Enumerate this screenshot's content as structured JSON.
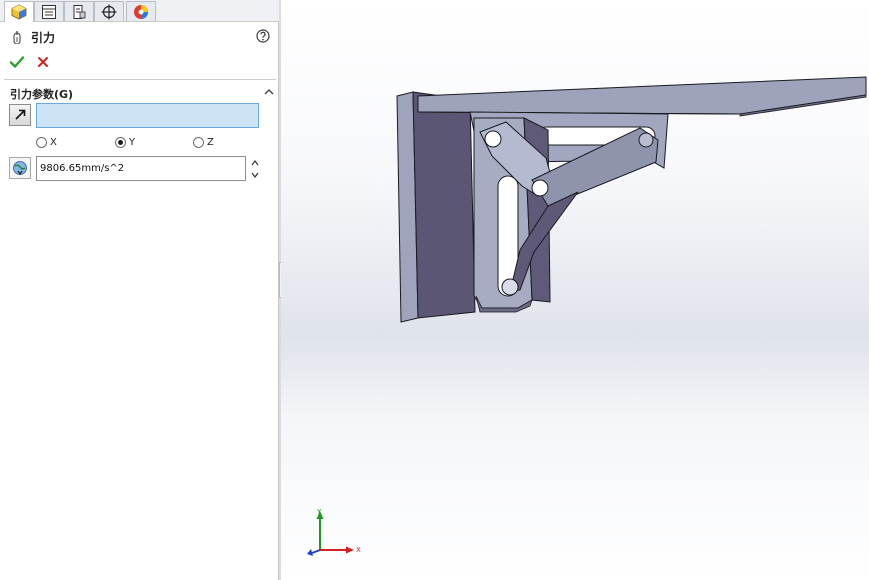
{
  "property_manager": {
    "title": "引力",
    "group": {
      "title": "引力参数(G)"
    },
    "direction": {
      "value": ""
    },
    "axes": [
      {
        "label": "X",
        "selected": false
      },
      {
        "label": "Y",
        "selected": true
      },
      {
        "label": "Z",
        "selected": false
      }
    ],
    "gravity": {
      "value": "9806.65mm/s^2"
    }
  },
  "tabs": [
    {
      "icon": "feature-manager-icon",
      "active": true
    },
    {
      "icon": "property-manager-icon",
      "active": false
    },
    {
      "icon": "configuration-manager-icon",
      "active": false
    },
    {
      "icon": "dimxpert-manager-icon",
      "active": false
    },
    {
      "icon": "display-manager-icon",
      "active": false
    }
  ],
  "triad": {
    "x_label": "X",
    "y_label": "Y"
  },
  "colors": {
    "ok": "#2f9e2f",
    "cancel": "#d42020",
    "selection_highlight": "#cde4f7",
    "model_face": "#9aa0b8",
    "model_dark": "#575370",
    "axis_x": "#d42020",
    "axis_y": "#1d9a1d",
    "axis_z": "#2040d0"
  }
}
